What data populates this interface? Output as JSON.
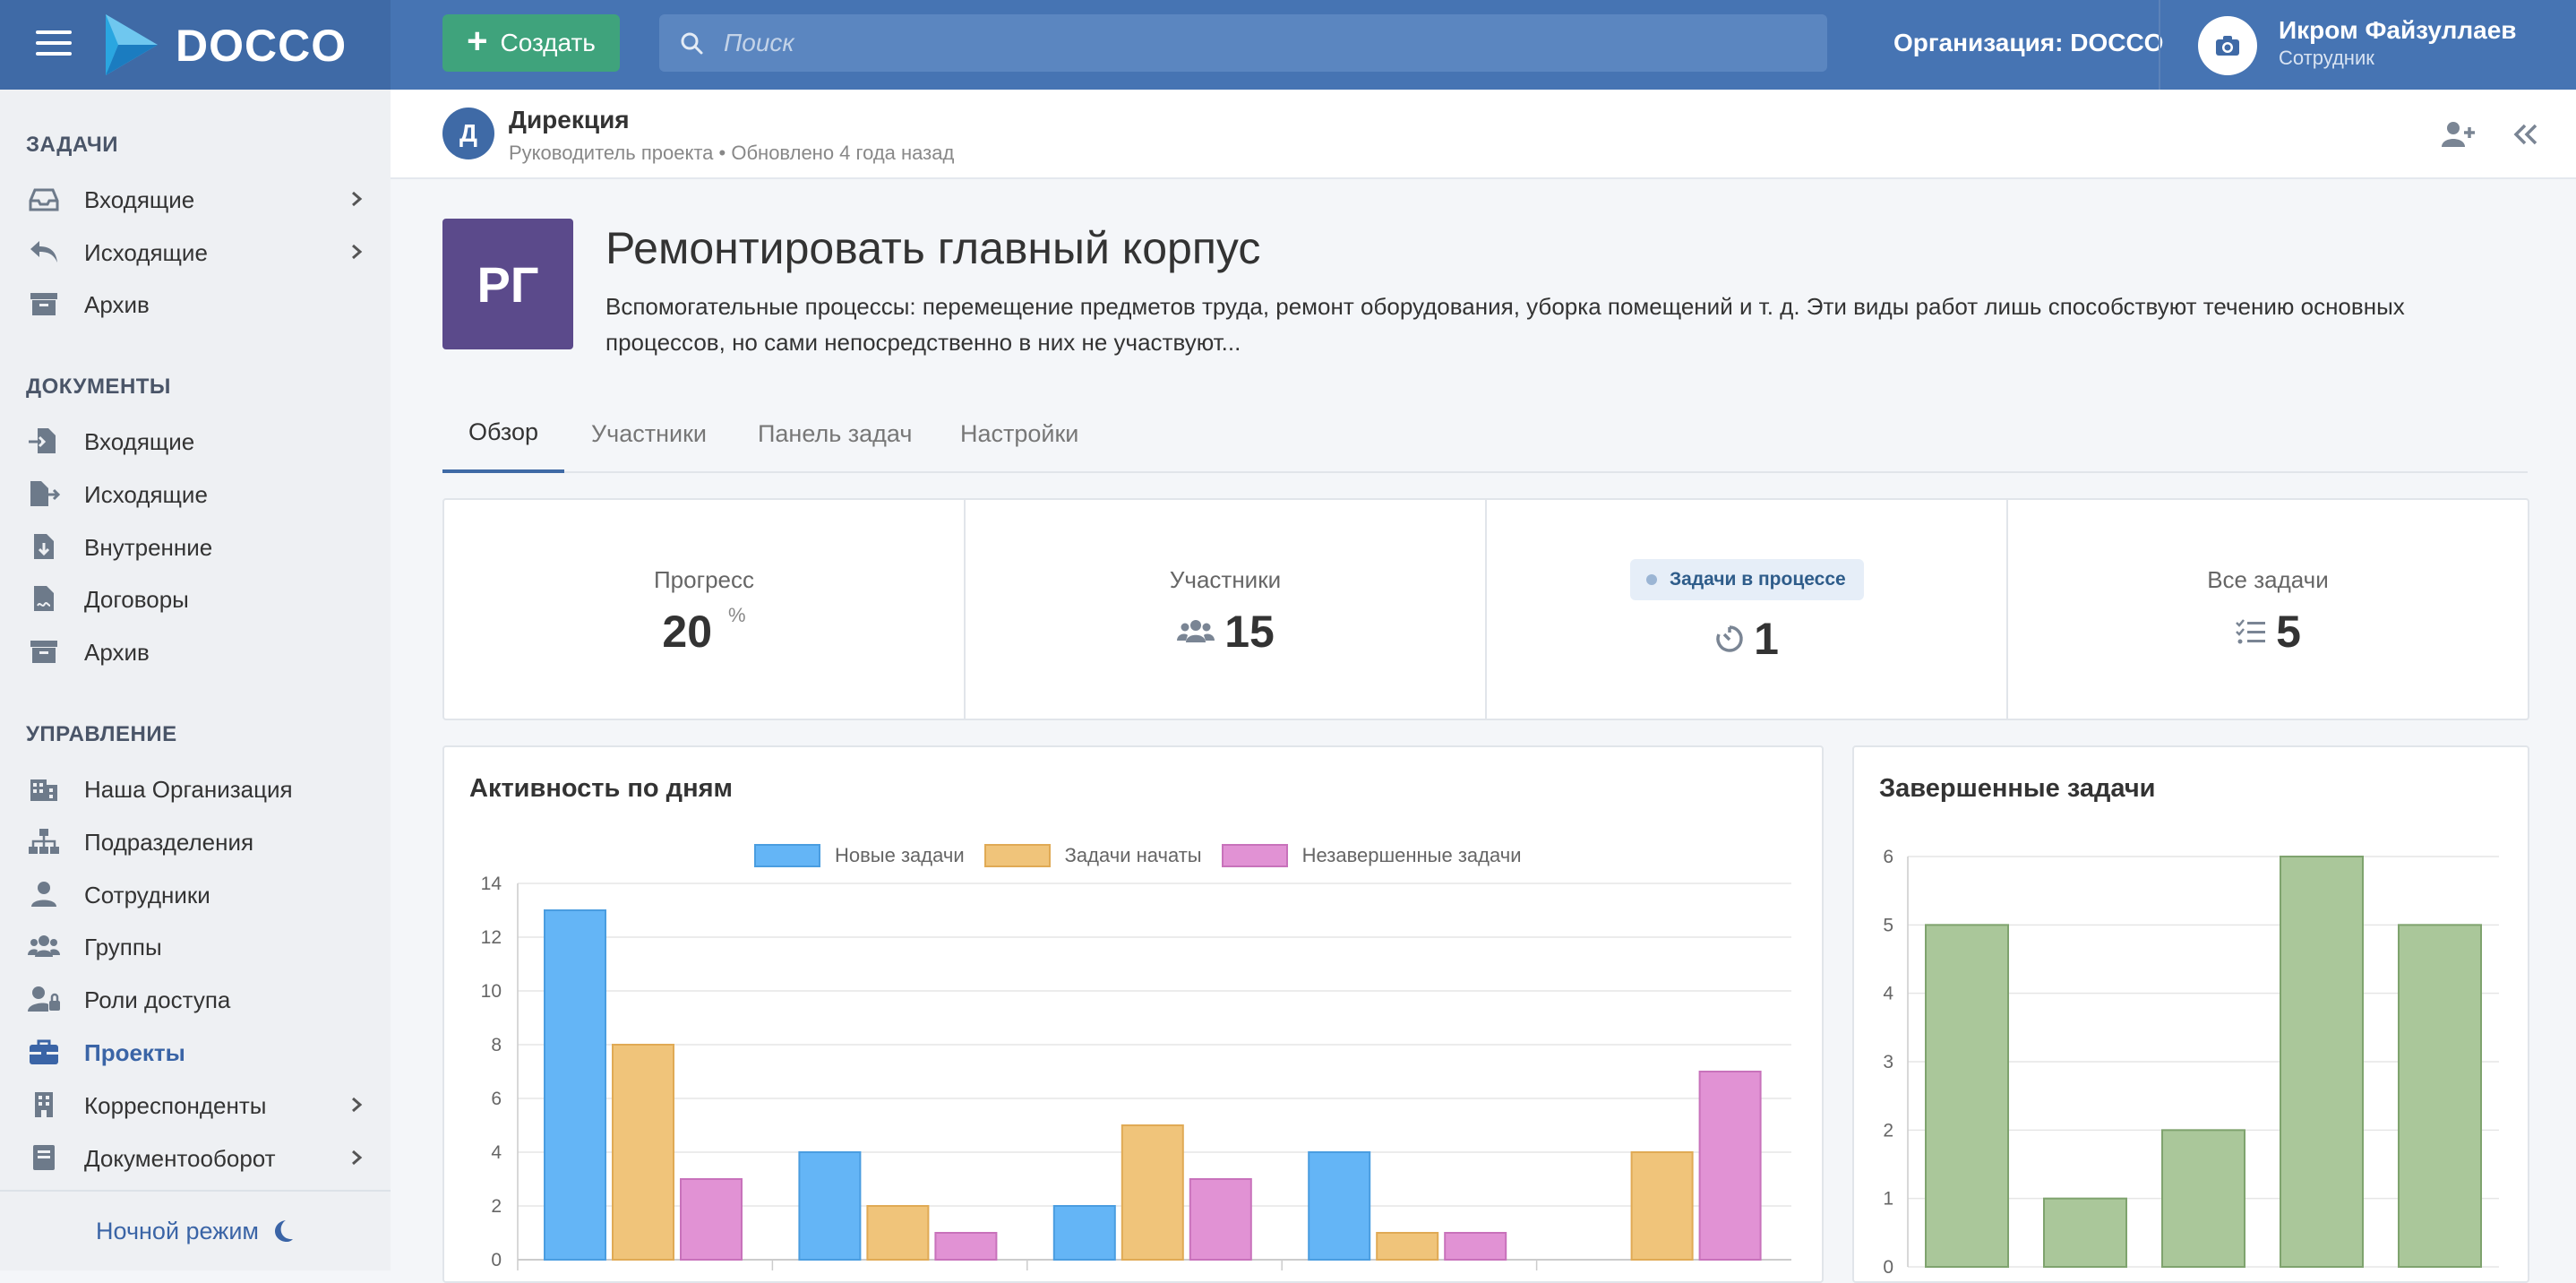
{
  "app": {
    "brand": "DOCCO"
  },
  "topbar": {
    "create_label": "Создать",
    "search_placeholder": "Поиск",
    "org_label": "Организация: DOCCO",
    "user_name": "Икром Файзуллаев",
    "user_role": "Сотрудник"
  },
  "sidebar": {
    "sections": [
      {
        "title": "ЗАДАЧИ",
        "items": [
          {
            "label": "Входящие",
            "icon": "inbox-icon",
            "chevron": true
          },
          {
            "label": "Исходящие",
            "icon": "reply-icon",
            "chevron": true
          },
          {
            "label": "Архив",
            "icon": "archive-icon",
            "chevron": false
          }
        ]
      },
      {
        "title": "ДОКУМЕНТЫ",
        "items": [
          {
            "label": "Входящие",
            "icon": "file-import-icon",
            "chevron": false
          },
          {
            "label": "Исходящие",
            "icon": "file-export-icon",
            "chevron": false
          },
          {
            "label": "Внутренние",
            "icon": "file-download-icon",
            "chevron": false
          },
          {
            "label": "Договоры",
            "icon": "file-contract-icon",
            "chevron": false
          },
          {
            "label": "Архив",
            "icon": "archive-icon",
            "chevron": false
          }
        ]
      },
      {
        "title": "УПРАВЛЕНИЕ",
        "items": [
          {
            "label": "Наша Организация",
            "icon": "building-icon",
            "chevron": false
          },
          {
            "label": "Подразделения",
            "icon": "sitemap-icon",
            "chevron": false
          },
          {
            "label": "Сотрудники",
            "icon": "user-icon",
            "chevron": false
          },
          {
            "label": "Группы",
            "icon": "users-icon",
            "chevron": false
          },
          {
            "label": "Роли доступа",
            "icon": "user-lock-icon",
            "chevron": false
          },
          {
            "label": "Проекты",
            "icon": "briefcase-icon",
            "chevron": false,
            "active": true
          },
          {
            "label": "Корреспонденты",
            "icon": "building-alt-icon",
            "chevron": true
          },
          {
            "label": "Документооборот",
            "icon": "book-icon",
            "chevron": true
          }
        ]
      }
    ],
    "night_mode": "Ночной режим"
  },
  "header": {
    "avatar_letter": "Д",
    "title": "Дирекция",
    "meta": "Руководитель проекта • Обновлено 4 года назад"
  },
  "project": {
    "avatar": "РГ",
    "title": "Ремонтировать главный корпус",
    "description": "Вспомогательные процессы: перемещение предметов труда, ремонт оборудования, уборка помещений и т. д. Эти виды работ лишь способствуют течению основных процессов, но сами непосредственно в них не участвуют..."
  },
  "tabs": [
    "Обзор",
    "Участники",
    "Панель задач",
    "Настройки"
  ],
  "stats": {
    "progress_label": "Прогресс",
    "progress_value": "20",
    "progress_unit": "%",
    "members_label": "Участники",
    "members_value": "15",
    "in_progress_label": "Задачи в процессе",
    "in_progress_value": "1",
    "all_label": "Все задачи",
    "all_value": "5"
  },
  "activity_card": {
    "title": "Активность по дням"
  },
  "completed_card": {
    "title": "Завершенные задачи"
  },
  "colors": {
    "brand": "#4674b3",
    "new_tasks": "#64b5f6",
    "started_tasks": "#f0c47a",
    "unfinished_tasks": "#e192d4",
    "completed": "#aac79a"
  },
  "chart_data": [
    {
      "type": "bar",
      "title": "Активность по дням",
      "categories": [
        "",
        "",
        "",
        "",
        ""
      ],
      "series": [
        {
          "name": "Новые задачи",
          "values": [
            13,
            4,
            2,
            4,
            0
          ]
        },
        {
          "name": "Задачи начаты",
          "values": [
            8,
            2,
            5,
            1,
            4
          ]
        },
        {
          "name": "Незавершенные задачи",
          "values": [
            3,
            1,
            3,
            1,
            7
          ]
        }
      ],
      "ylim": [
        0,
        14
      ],
      "yticks": [
        0,
        2,
        4,
        6,
        8,
        10,
        12,
        14
      ],
      "legend": "top",
      "grid": true
    },
    {
      "type": "bar",
      "title": "Завершенные задачи",
      "categories": [
        "",
        "",
        "",
        "",
        ""
      ],
      "values": [
        5,
        1,
        2,
        6,
        5
      ],
      "ylim": [
        0,
        6
      ],
      "yticks": [
        0,
        1,
        2,
        3,
        4,
        5,
        6
      ],
      "grid": true
    }
  ]
}
